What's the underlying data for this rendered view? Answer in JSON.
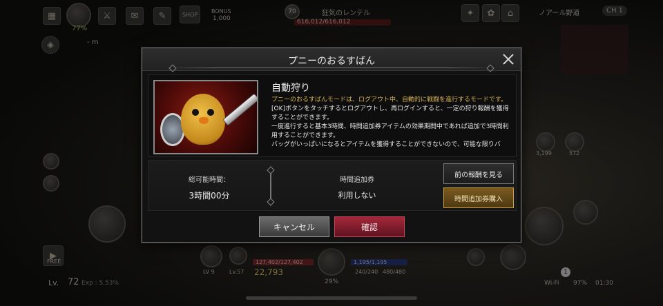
{
  "hud": {
    "percent_top": "77%",
    "bonus_label": "BONUS",
    "bonus_value": "1,000",
    "shop_label": "SHOP",
    "boss_level": "70",
    "boss_name": "狂気のレンテル",
    "boss_hp": "616,012/616,012",
    "zone_name": "ノアール野道",
    "channel": "CH 1",
    "distance": "- m",
    "free_label": "FREE",
    "player_level_label": "Lv.",
    "player_level": "72",
    "exp": "Exp : 5.53%",
    "lv_a": "LV 9",
    "lv_b": "Lv.57",
    "hp": "127,402/127,402",
    "mp": "1,195/1,195",
    "gold": "22,793",
    "center_percent": "29%",
    "pot_a": "240/240",
    "pot_b": "480/480",
    "potion_count_a": "3,199",
    "potion_count_b": "572",
    "notif_count": "1",
    "wifi": "Wi-Fi",
    "battery": "97%",
    "time": "01:30",
    "colors": {
      "hp": "#7a2a2a",
      "mp": "#2a3a7a"
    }
  },
  "modal": {
    "title": "プニーのおるすばん",
    "info": {
      "heading": "自動狩り",
      "lines": [
        "プニーのおるすばんモードは、ログアウト中、自動的に戦闘を進行するモードです。",
        "[OK]ボタンをタッチするとログアウトし、再ログインすると、一定の狩り報酬を獲得することができます。",
        "一度進行すると基本3時間、時間追加券アイテムの効果期間中であれば追加で3時間利用することができます。",
        "バッグがいっぱいになるとアイテムを獲得することができないので、可能な限りバ"
      ]
    },
    "total_time_label": "総可能時間：",
    "total_time_value": "3時間00分",
    "ticket_label": "時間追加券",
    "ticket_value": "利用しない",
    "prev_reward_button": "前の報酬を見る",
    "buy_ticket_button": "時間追加券購入",
    "cancel_button": "キャンセル",
    "confirm_button": "確認"
  }
}
